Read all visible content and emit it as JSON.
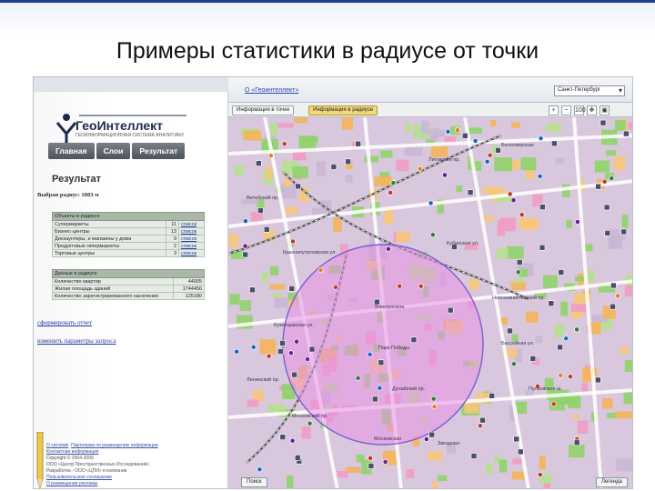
{
  "slide": {
    "title": "Примеры статистики в радиусе от точки"
  },
  "brand": {
    "name": "ГеоИнтеллект",
    "tagline": "ГЕОИНФОРМАЦИОННАЯ СИСТЕМА АНАЛИТИКИ",
    "accent": "#1b3f8f"
  },
  "nav": {
    "items": [
      "Главная",
      "Слои",
      "Результат"
    ]
  },
  "result": {
    "title": "Результат",
    "radius_line": "Выбран радиус: 1883 м"
  },
  "objects_table": {
    "header": "Объекты в радиусе",
    "rows": [
      {
        "name": "Супермаркеты",
        "count": "11",
        "link": "список"
      },
      {
        "name": "Бизнес-центры",
        "count": "13",
        "link": "список"
      },
      {
        "name": "Дискаунтеры, и магазины у дома",
        "count": "9",
        "link": "список"
      },
      {
        "name": "Продуктовые гипермаркеты",
        "count": "2",
        "link": "список"
      },
      {
        "name": "Торговые центры",
        "count": "3",
        "link": "список"
      }
    ]
  },
  "area_table": {
    "header": "Данные в радиусе",
    "rows": [
      {
        "name": "Количество квартир",
        "value": "44005"
      },
      {
        "name": "Жилая площадь зданий",
        "value": "1744456"
      },
      {
        "name": "Количество зарегистрированного населения",
        "value": "125180"
      }
    ]
  },
  "actions": {
    "report": "сформировать отчет",
    "change_params": "изменить параметры запроса"
  },
  "footer": {
    "links": [
      "О системе",
      "Партнерам по размещению информации",
      "Контактная информация"
    ],
    "lines": [
      "Copyright © 2004-2009",
      "ООО «Центр Пространственных Исследований»",
      "Разработка - ООО «ЦПИ» и компании",
      "Пользовательское соглашение",
      "О размещении рекламы"
    ]
  },
  "map": {
    "home_link": "О «Геоинтеллект»",
    "city": "Санкт-Петербург",
    "tools": {
      "point_info": "Информация в точке",
      "radius_info": "Информация в радиусе"
    },
    "zoom_labels": [
      "+",
      "−",
      "100"
    ],
    "search": "Поиск",
    "legend": "Легенда",
    "street_labels": [
      "Белоозерская",
      "Лиговский пр.",
      "Московский пр.",
      "Электросила",
      "Парк Победы",
      "Московская",
      "Звездная",
      "Кузнецовская ул.",
      "Бассейная ул.",
      "Ленинский пр.",
      "Кубинская ул.",
      "Дунайский пр.",
      "Краснопутиловская ул.",
      "Пулковское ш.",
      "Витебский пр.",
      "Новоизмайловский пр."
    ],
    "colors": {
      "base": "#d9c7dd",
      "green": "#8fd36a",
      "orange": "#f3b55a",
      "pink": "#ef9cc2",
      "circle_fill": "#e892e4",
      "circle_stroke": "#7b5fd0",
      "rail": "#5a5a5a"
    }
  }
}
